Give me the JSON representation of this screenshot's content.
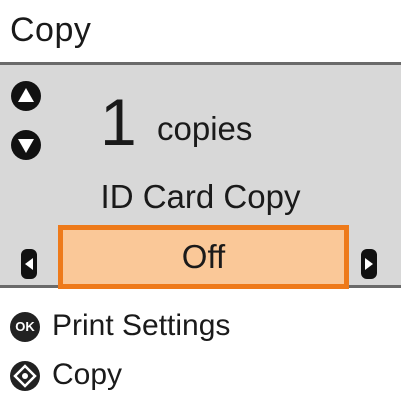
{
  "header": {
    "title": "Copy"
  },
  "copies": {
    "count": "1",
    "label": "copies"
  },
  "setting": {
    "label": "ID Card Copy",
    "value": "Off"
  },
  "options": {
    "ok_key_label": "OK",
    "print_settings_label": "Print Settings",
    "copy_label": "Copy"
  },
  "colors": {
    "panel": "#d8d8d8",
    "highlight_fill": "#fac898",
    "highlight_border": "#ee7a1a"
  }
}
